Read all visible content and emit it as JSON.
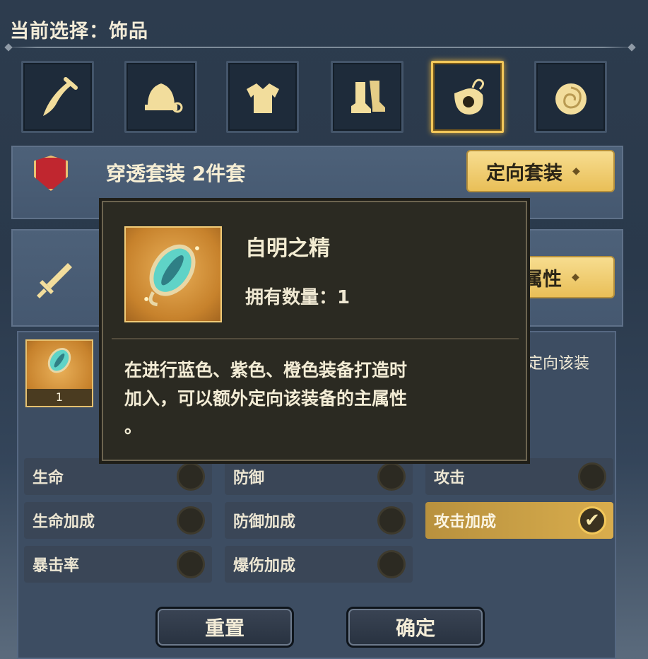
{
  "header": {
    "title": "当前选择：饰品"
  },
  "slots": [
    {
      "icon": "weapon-icon",
      "selected": false
    },
    {
      "icon": "helmet-icon",
      "selected": false
    },
    {
      "icon": "armor-icon",
      "selected": false
    },
    {
      "icon": "boots-icon",
      "selected": false
    },
    {
      "icon": "accessory-icon",
      "selected": true
    },
    {
      "icon": "ring-icon",
      "selected": false
    }
  ],
  "set_panel": {
    "label": "穿透套装 2件套",
    "button_label": "定向套装"
  },
  "main_attr_panel": {
    "button_label": "主属性"
  },
  "tooltip": {
    "name": "自明之精",
    "count_text": "拥有数量：1",
    "description_line1": "在进行蓝色、紫色、橙色装备打造时",
    "description_line2": "加入，可以额外定向该装备的主属性",
    "description_line3": "。"
  },
  "item_slot": {
    "count": "1"
  },
  "side_text": "定向该装",
  "attributes": [
    {
      "label": "生命",
      "checked": false
    },
    {
      "label": "防御",
      "checked": false
    },
    {
      "label": "攻击",
      "checked": false
    },
    {
      "label": "生命加成",
      "checked": false
    },
    {
      "label": "防御加成",
      "checked": false
    },
    {
      "label": "攻击加成",
      "checked": true
    },
    {
      "label": "暴击率",
      "checked": false
    },
    {
      "label": "爆伤加成",
      "checked": false
    }
  ],
  "buttons": {
    "reset": "重置",
    "confirm": "确定"
  },
  "colors": {
    "accent_gold": "#f2c75a",
    "tooltip_bg": "#2b2a22",
    "panel_bg": "#4d6179"
  }
}
